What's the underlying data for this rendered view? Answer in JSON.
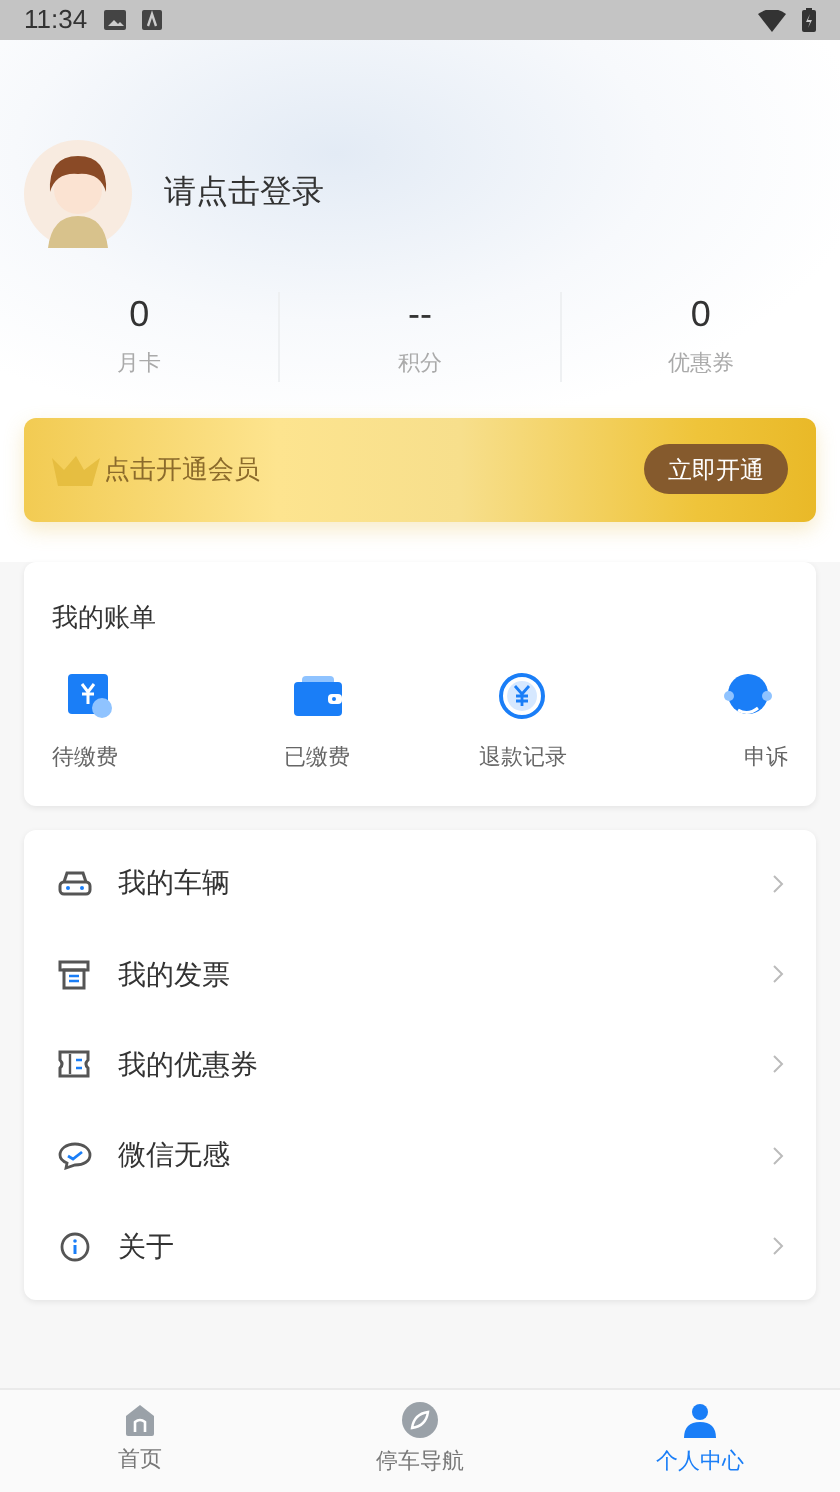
{
  "status_bar": {
    "time": "11:34"
  },
  "profile": {
    "login_prompt": "请点击登录"
  },
  "stats": [
    {
      "value": "0",
      "label": "月卡"
    },
    {
      "value": "--",
      "label": "积分"
    },
    {
      "value": "0",
      "label": "优惠券"
    }
  ],
  "membership": {
    "text": "点击开通会员",
    "button": "立即开通"
  },
  "bills": {
    "title": "我的账单",
    "items": [
      {
        "kind": "pending",
        "label": "待缴费"
      },
      {
        "kind": "paid",
        "label": "已缴费"
      },
      {
        "kind": "refund",
        "label": "退款记录"
      },
      {
        "kind": "complaint",
        "label": "申诉"
      }
    ]
  },
  "menu": [
    {
      "kind": "car",
      "label": "我的车辆"
    },
    {
      "kind": "invoice",
      "label": "我的发票"
    },
    {
      "kind": "coupon",
      "label": "我的优惠券"
    },
    {
      "kind": "wechat",
      "label": "微信无感"
    },
    {
      "kind": "about",
      "label": "关于"
    }
  ],
  "tab_bar": [
    {
      "kind": "home",
      "label": "首页",
      "selected": false
    },
    {
      "kind": "nav",
      "label": "停车导航",
      "selected": false
    },
    {
      "kind": "profile",
      "label": "个人中心",
      "selected": true
    }
  ]
}
